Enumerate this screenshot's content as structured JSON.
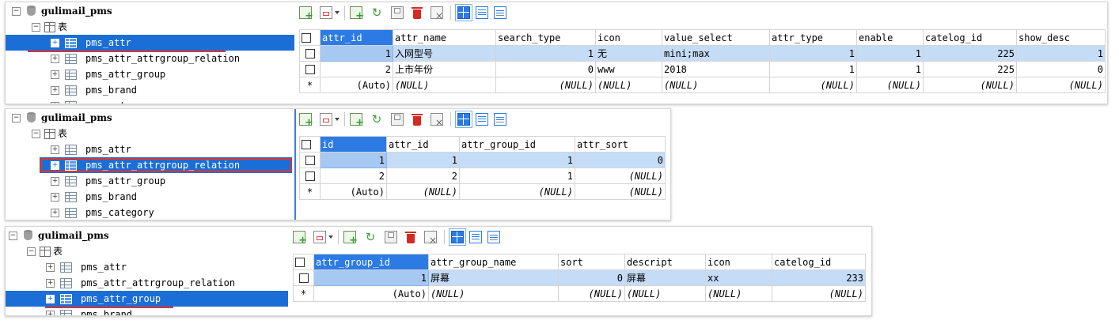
{
  "panels": [
    {
      "tree": {
        "db_name": "gulimail_pms",
        "group_label": "表",
        "items": [
          "pms_attr",
          "pms_attr_attrgroup_relation",
          "pms_attr_group",
          "pms_brand",
          "pms_category"
        ],
        "selected": "pms_attr"
      },
      "grid": {
        "columns": [
          "attr_id",
          "attr_name",
          "search_type",
          "icon",
          "value_select",
          "attr_type",
          "enable",
          "catelog_id",
          "show_desc"
        ],
        "rows": [
          [
            "1",
            "入网型号",
            "1",
            "无",
            "mini;max",
            "1",
            "1",
            "225",
            "1"
          ],
          [
            "2",
            "上市年份",
            "0",
            "www",
            "2018",
            "1",
            "1",
            "225",
            "0"
          ],
          [
            "(Auto)",
            "(NULL)",
            "(NULL)",
            "(NULL)",
            "(NULL)",
            "(NULL)",
            "(NULL)",
            "(NULL)",
            "(NULL)"
          ]
        ],
        "new_row_marker": "*"
      }
    },
    {
      "tree": {
        "db_name": "gulimail_pms",
        "group_label": "表",
        "items": [
          "pms_attr",
          "pms_attr_attrgroup_relation",
          "pms_attr_group",
          "pms_brand",
          "pms_category"
        ],
        "selected": "pms_attr_attrgroup_relation"
      },
      "grid": {
        "columns": [
          "id",
          "attr_id",
          "attr_group_id",
          "attr_sort"
        ],
        "rows": [
          [
            "1",
            "1",
            "1",
            "0"
          ],
          [
            "2",
            "2",
            "1",
            "(NULL)"
          ],
          [
            "(Auto)",
            "(NULL)",
            "(NULL)",
            "(NULL)"
          ]
        ],
        "new_row_marker": "*"
      }
    },
    {
      "tree": {
        "db_name": "gulimail_pms",
        "group_label": "表",
        "items": [
          "pms_attr",
          "pms_attr_attrgroup_relation",
          "pms_attr_group",
          "pms_brand"
        ],
        "selected": "pms_attr_group"
      },
      "grid": {
        "columns": [
          "attr_group_id",
          "attr_group_name",
          "sort",
          "descript",
          "icon",
          "catelog_id"
        ],
        "rows": [
          [
            "1",
            "屏幕",
            "0",
            "屏幕",
            "xx",
            "233"
          ],
          [
            "(Auto)",
            "(NULL)",
            "(NULL)",
            "(NULL)",
            "(NULL)",
            "(NULL)"
          ]
        ],
        "new_row_marker": "*"
      }
    }
  ],
  "toolbar": {
    "icons": [
      "new-record-icon",
      "insert-dropdown-icon",
      "copy-record-icon",
      "refresh-icon",
      "save-icon",
      "delete-icon",
      "clear-filter-icon",
      "grid-view-icon",
      "form-view-icon",
      "text-view-icon"
    ]
  },
  "colors": {
    "selection": "#1b6ed6",
    "header_active": "#2c7be5",
    "row_highlight": "#c5dcf7",
    "annotation_red": "#e0332e"
  }
}
